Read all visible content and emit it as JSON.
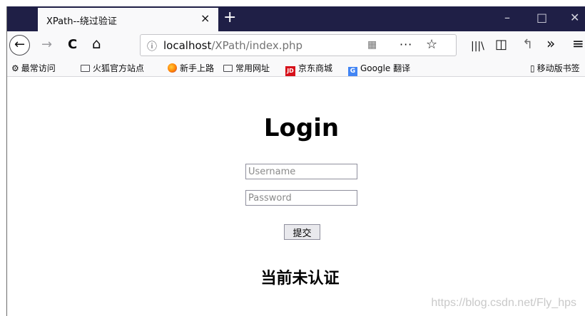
{
  "browser": {
    "tab_title": "XPath--绕过验证",
    "tab_close": "×",
    "new_tab": "+",
    "window_controls": [
      "–",
      "□",
      "✕"
    ]
  },
  "navbar": {
    "back": "←",
    "forward": "→",
    "reload": "C",
    "home": "⌂",
    "url_info": "ⓘ",
    "url_host": "localhost",
    "url_path": "/XPath/index.php",
    "qr": "▦",
    "more": "···",
    "star": "☆",
    "library": "|||\\",
    "sidebar": "◫",
    "back_arrow": "↰",
    "overflow": "»",
    "menu": "≡"
  },
  "bookmarks": {
    "items": [
      {
        "label": "最常访问",
        "icon": "gear-icon"
      },
      {
        "label": "火狐官方站点",
        "icon": "folder-icon"
      },
      {
        "label": "新手上路",
        "icon": "firefox-icon"
      },
      {
        "label": "常用网址",
        "icon": "folder-icon"
      },
      {
        "label": "京东商城",
        "icon": "jd-icon"
      },
      {
        "label": "Google 翻译",
        "icon": "google-translate-icon"
      }
    ],
    "mobile": "移动版书签"
  },
  "page": {
    "title": "Login",
    "username_placeholder": "Username",
    "password_placeholder": "Password",
    "submit_label": "提交",
    "status": "当前未认证"
  },
  "watermark": "https://blog.csdn.net/Fly_hps"
}
